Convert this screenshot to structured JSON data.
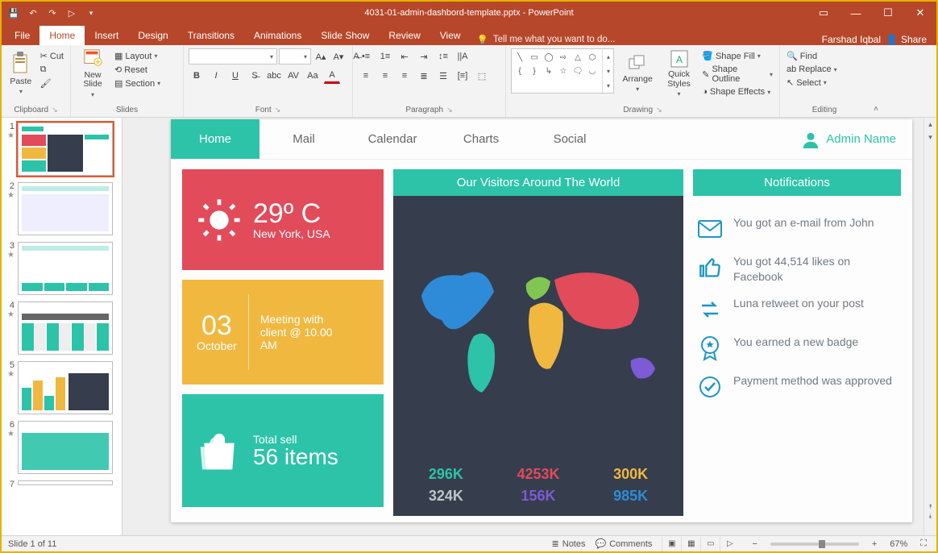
{
  "app": {
    "title": "4031-01-admin-dashbord-template.pptx - PowerPoint",
    "user": "Farshad Iqbal",
    "share": "Share"
  },
  "tabs": {
    "file": "File",
    "home": "Home",
    "insert": "Insert",
    "design": "Design",
    "transitions": "Transitions",
    "animations": "Animations",
    "slideshow": "Slide Show",
    "review": "Review",
    "view": "View",
    "tellme": "Tell me what you want to do..."
  },
  "ribbon": {
    "clipboard": {
      "title": "Clipboard",
      "paste": "Paste",
      "cut": "Cut",
      "copy": "Copy",
      "format_painter": ""
    },
    "slides": {
      "title": "Slides",
      "new_slide": "New\nSlide",
      "layout": "Layout",
      "reset": "Reset",
      "section": "Section"
    },
    "font": {
      "title": "Font"
    },
    "paragraph": {
      "title": "Paragraph"
    },
    "drawing": {
      "title": "Drawing",
      "arrange": "Arrange",
      "quick_styles": "Quick\nStyles",
      "shape_fill": "Shape Fill",
      "shape_outline": "Shape Outline",
      "shape_effects": "Shape Effects"
    },
    "editing": {
      "title": "Editing",
      "find": "Find",
      "replace": "Replace",
      "select": "Select"
    }
  },
  "status": {
    "slide_info": "Slide 1 of 11",
    "notes": "Notes",
    "comments": "Comments",
    "zoom": "67%"
  },
  "thumbs": {
    "count": 7,
    "total": 11,
    "selected": 1
  },
  "dash": {
    "nav": {
      "home": "Home",
      "mail": "Mail",
      "calendar": "Calendar",
      "charts": "Charts",
      "social": "Social",
      "admin": "Admin Name"
    },
    "weather": {
      "temp": "29º C",
      "loc": "New York, USA"
    },
    "meeting": {
      "day": "03",
      "month": "October",
      "text": "Meeting with client @ 10.00 AM"
    },
    "sales": {
      "label": "Total sell",
      "value": "56 items"
    },
    "world": {
      "title": "Our Visitors Around The World",
      "stats": [
        "296K",
        "4253K",
        "300K",
        "324K",
        "156K",
        "985K"
      ]
    },
    "notif": {
      "title": "Notifications",
      "items": [
        "You got an e-mail from John",
        "You got 44,514 likes on Facebook",
        "Luna retweet on your post",
        "You earned a new badge",
        "Payment method was approved"
      ]
    }
  }
}
